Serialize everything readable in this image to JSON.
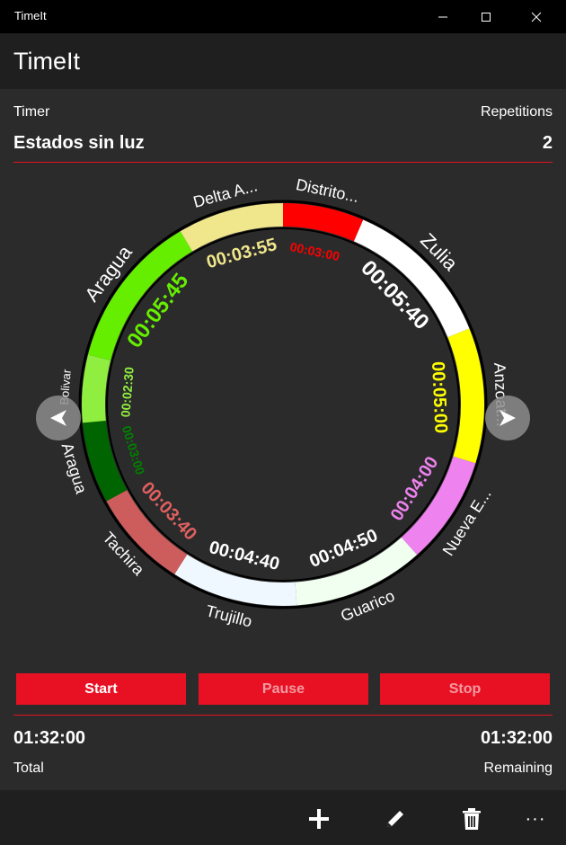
{
  "window": {
    "title": "TimeIt"
  },
  "app": {
    "heading": "TimeIt"
  },
  "timer": {
    "label": "Timer",
    "name": "Estados sin luz",
    "repetitions_label": "Repetitions",
    "repetitions": "2"
  },
  "segments": [
    {
      "name": "Distrito...",
      "time": "00:03:00",
      "color": "#ff0000",
      "text_color": "#ff0000",
      "minutes": 3.0
    },
    {
      "name": "Zulia",
      "time": "00:05:40",
      "color": "#ffffff",
      "text_color": "#ffffff",
      "minutes": 5.667
    },
    {
      "name": "Anzoat...",
      "time": "00:05:00",
      "color": "#ffff00",
      "text_color": "#ffff00",
      "minutes": 5.0
    },
    {
      "name": "Nueva E...",
      "time": "00:04:00",
      "color": "#ee82ee",
      "text_color": "#ee82ee",
      "minutes": 4.0
    },
    {
      "name": "Guarico",
      "time": "00:04:50",
      "color": "#f0fff0",
      "text_color": "#ffffff",
      "minutes": 4.833
    },
    {
      "name": "Trujillo",
      "time": "00:04:40",
      "color": "#f0f8ff",
      "text_color": "#ffffff",
      "minutes": 4.667
    },
    {
      "name": "Tachira",
      "time": "00:03:40",
      "color": "#cd5c5c",
      "text_color": "#e06060",
      "minutes": 3.667
    },
    {
      "name": "Aragua",
      "time": "00:03:00",
      "color": "#006400",
      "text_color": "#008000",
      "minutes": 3.0
    },
    {
      "name": "Bolivar",
      "time": "00:02:30",
      "color": "#90ee40",
      "text_color": "#90ee40",
      "minutes": 2.5
    },
    {
      "name": "Aragua",
      "time": "00:05:45",
      "color": "#66ee00",
      "text_color": "#66ee00",
      "minutes": 5.75
    },
    {
      "name": "Delta A...",
      "time": "00:03:55",
      "color": "#f0e68c",
      "text_color": "#f0e68c",
      "minutes": 3.917
    }
  ],
  "controls": {
    "start": "Start",
    "pause": "Pause",
    "stop": "Stop"
  },
  "totals": {
    "total_value": "01:32:00",
    "total_label": "Total",
    "remaining_value": "01:32:00",
    "remaining_label": "Remaining"
  },
  "commands": {
    "add_icon": "plus-icon",
    "edit_icon": "pencil-icon",
    "delete_icon": "trash-icon",
    "more_label": "···"
  },
  "colors": {
    "accent": "#e81123",
    "background": "#2b2b2b",
    "bar": "#1f1f1f"
  }
}
